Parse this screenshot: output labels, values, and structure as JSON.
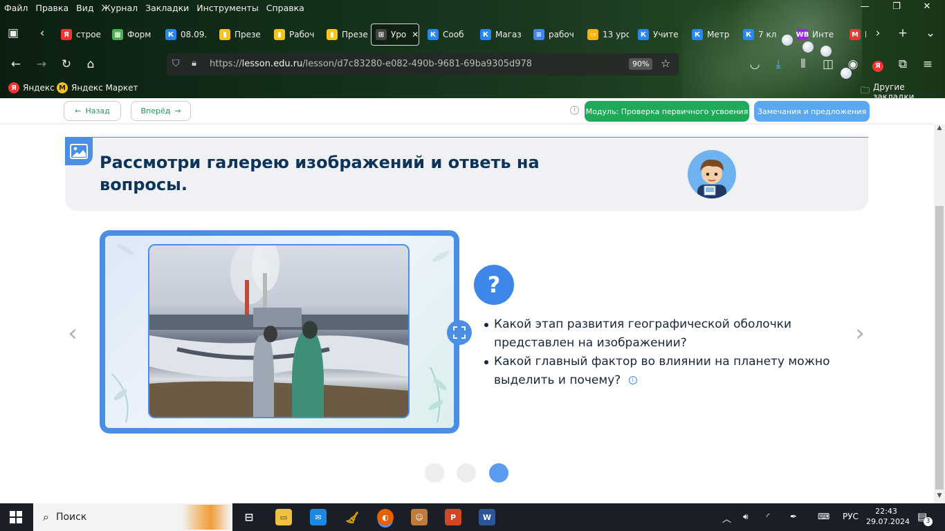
{
  "menu": [
    "Файл",
    "Правка",
    "Вид",
    "Журнал",
    "Закладки",
    "Инструменты",
    "Справка"
  ],
  "tabs": [
    {
      "label": "строе",
      "icon": "Я",
      "color": "#f33",
      "iconname": "yandex-icon"
    },
    {
      "label": "Форм",
      "icon": "▦",
      "color": "#4caf50",
      "iconname": "sheets-icon"
    },
    {
      "label": "08.09.",
      "icon": "К",
      "color": "#2787f5",
      "iconname": "vk-icon"
    },
    {
      "label": "Презе",
      "icon": "▮",
      "color": "#f5c518",
      "iconname": "slides-icon"
    },
    {
      "label": "Рабоч",
      "icon": "▮",
      "color": "#f5c518",
      "iconname": "slides-icon"
    },
    {
      "label": "Презе",
      "icon": "▮",
      "color": "#f5c518",
      "iconname": "slides-icon"
    },
    {
      "label": "Уро",
      "icon": "⊞",
      "color": "#444",
      "iconname": "lesson-icon"
    },
    {
      "label": "Сооб",
      "icon": "К",
      "color": "#2787f5",
      "iconname": "vk-icon"
    },
    {
      "label": "Магаз",
      "icon": "К",
      "color": "#2787f5",
      "iconname": "vk-icon"
    },
    {
      "label": "рабоч",
      "icon": "≡",
      "color": "#4285f4",
      "iconname": "docs-icon"
    },
    {
      "label": "13 уро",
      "icon": "▭",
      "color": "#f5b400",
      "iconname": "slides-icon"
    },
    {
      "label": "Учите",
      "icon": "К",
      "color": "#2787f5",
      "iconname": "vk-icon"
    },
    {
      "label": "Метр",
      "icon": "К",
      "color": "#2787f5",
      "iconname": "vk-icon"
    },
    {
      "label": "7 кл",
      "icon": "К",
      "color": "#2787f5",
      "iconname": "vk-icon"
    },
    {
      "label": "Инте",
      "icon": "WB",
      "color": "#a020f0",
      "iconname": "wildberries-icon"
    },
    {
      "label": "П",
      "icon": "М",
      "color": "#e53935",
      "iconname": "gmail-icon"
    }
  ],
  "url": {
    "prefix": "https://",
    "host": "lesson.edu.ru",
    "path": "/lesson/d7c83280-e082-490b-9681-69ba9305d978",
    "zoom": "90%"
  },
  "bookmarks": {
    "yandex": "Яндекс",
    "market": "Яндекс Маркет",
    "other": "Другие закладки"
  },
  "nav": {
    "back": "Назад",
    "forward": "Вперёд",
    "module": "Модуль: Проверка первичного усвоения",
    "feedback": "Замечания и предложения"
  },
  "task": {
    "title": "Рассмотри галерею изображений и ответь на вопросы."
  },
  "questions": [
    "Какой этап развития географической оболочки представлен на изображении?",
    "Какой главный фактор во влиянии на планету можно выделить и почему?"
  ],
  "slider": {
    "total": 3,
    "current": 3
  },
  "taskbar": {
    "search": "Поиск",
    "lang": "РУС",
    "time": "22:43",
    "date": "29.07.2024",
    "notifications": "3"
  },
  "colors": {
    "green": "#1faa5a",
    "blue": "#4b8ee6",
    "navy": "#0e3358"
  }
}
